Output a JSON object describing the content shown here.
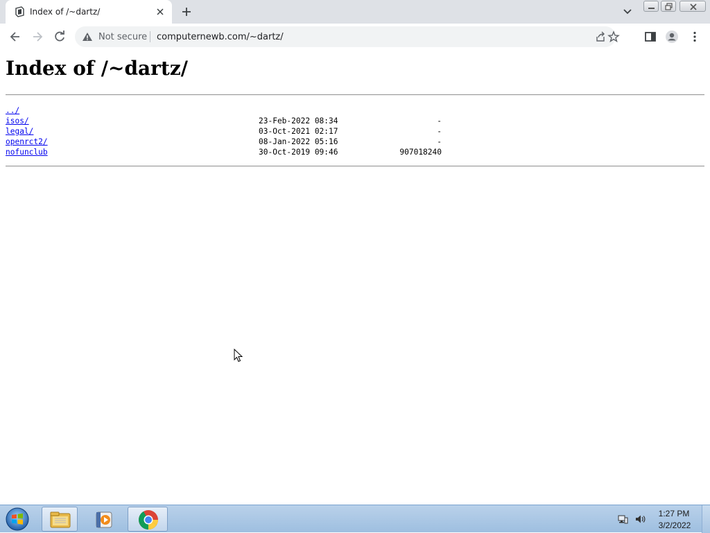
{
  "browser": {
    "tab_title": "Index of /~dartz/",
    "address": {
      "security_label": "Not secure",
      "url": "computernewb.com/~dartz/"
    }
  },
  "page": {
    "heading": "Index of /~dartz/",
    "entries": [
      {
        "name": "../",
        "date": "",
        "size": ""
      },
      {
        "name": "isos/",
        "date": "23-Feb-2022 08:34",
        "size": "-"
      },
      {
        "name": "legal/",
        "date": "03-Oct-2021 02:17",
        "size": "-"
      },
      {
        "name": "openrct2/",
        "date": "08-Jan-2022 05:16",
        "size": "-"
      },
      {
        "name": "nofunclub",
        "date": "30-Oct-2019 09:46",
        "size": "907018240"
      }
    ]
  },
  "taskbar": {
    "clock_time": "1:27 PM",
    "clock_date": "3/2/2022",
    "pinned": [
      "explorer-icon",
      "media-player-icon",
      "chrome-icon"
    ]
  },
  "icons": {
    "back": "arrow-left-icon",
    "forward": "arrow-right-icon",
    "reload": "reload-icon",
    "warning": "warning-triangle-icon",
    "share": "share-icon",
    "bookmark": "star-icon",
    "side_panel": "side-panel-icon",
    "profile": "profile-icon",
    "menu": "kebab-menu-icon"
  },
  "colors": {
    "link": "#0000ee",
    "tabstrip_bg": "#dee1e6",
    "omnibox_bg": "#f1f3f4"
  }
}
